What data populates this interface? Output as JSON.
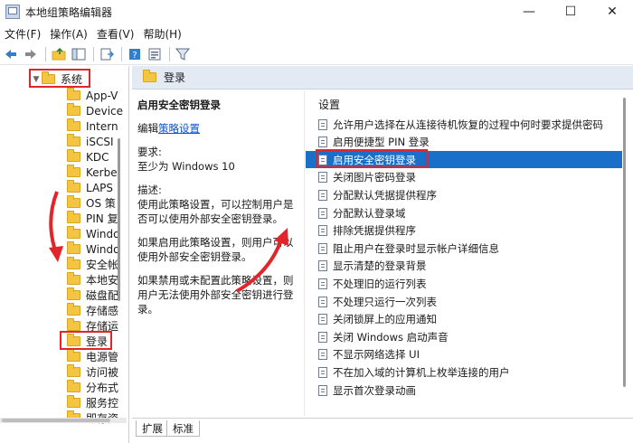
{
  "window": {
    "title": "本地组策略编辑器",
    "minimize_glyph": "—",
    "maximize_glyph": "☐",
    "close_glyph": "✕"
  },
  "menu": [
    "文件(F)",
    "操作(A)",
    "查看(V)",
    "帮助(H)"
  ],
  "toolbar_icons": [
    "back-icon",
    "forward-icon",
    "up-folder-icon",
    "show-tree-icon",
    "export-icon",
    "help-icon",
    "properties-icon",
    "filter-icon"
  ],
  "tree": {
    "parent": "系统",
    "items": [
      "App-V",
      "Device",
      "Intern",
      "iSCSI",
      "KDC",
      "Kerbe",
      "LAPS",
      "OS 策",
      "PIN 复",
      "Windo",
      "Windo",
      "安全帐",
      "本地安",
      "磁盘配",
      "存储感",
      "存储运",
      "登录",
      "电源管",
      "访问被",
      "分布式",
      "服务控",
      "即存资"
    ],
    "selected": "登录"
  },
  "right": {
    "header": "登录",
    "description": {
      "title": "启用安全密钥登录",
      "edit_prefix": "编辑",
      "edit_link": "策略设置",
      "requirement_label": "要求:",
      "requirement_value": "至少为 Windows 10",
      "description_label": "描述:",
      "paragraph1": "使用此策略设置，可以控制用户是否可以使用外部安全密钥登录。",
      "paragraph2": "如果启用此策略设置，则用户可以使用外部安全密钥登录。",
      "paragraph3": "如果禁用或未配置此策略设置，则用户无法使用外部安全密钥进行登录。"
    },
    "list_header": "设置",
    "settings": [
      "允许用户选择在从连接待机恢复的过程中何时要求提供密码",
      "启用便捷型 PIN 登录",
      "启用安全密钥登录",
      "关闭图片密码登录",
      "分配默认凭据提供程序",
      "分配默认登录域",
      "排除凭据提供程序",
      "阻止用户在登录时显示帐户详细信息",
      "显示清楚的登录背景",
      "不处理旧的运行列表",
      "不处理只运行一次列表",
      "关闭锁屏上的应用通知",
      "关闭 Windows 启动声音",
      "不显示网络选择 UI",
      "不在加入域的计算机上枚举连接的用户",
      "显示首次登录动画"
    ],
    "selected_setting": "启用安全密钥登录",
    "tabs": [
      "扩展",
      "标准"
    ]
  },
  "colors": {
    "selection": "#1a6fc9",
    "annotation_red": "#e0262b",
    "header_bg": "#e3eaf4"
  }
}
